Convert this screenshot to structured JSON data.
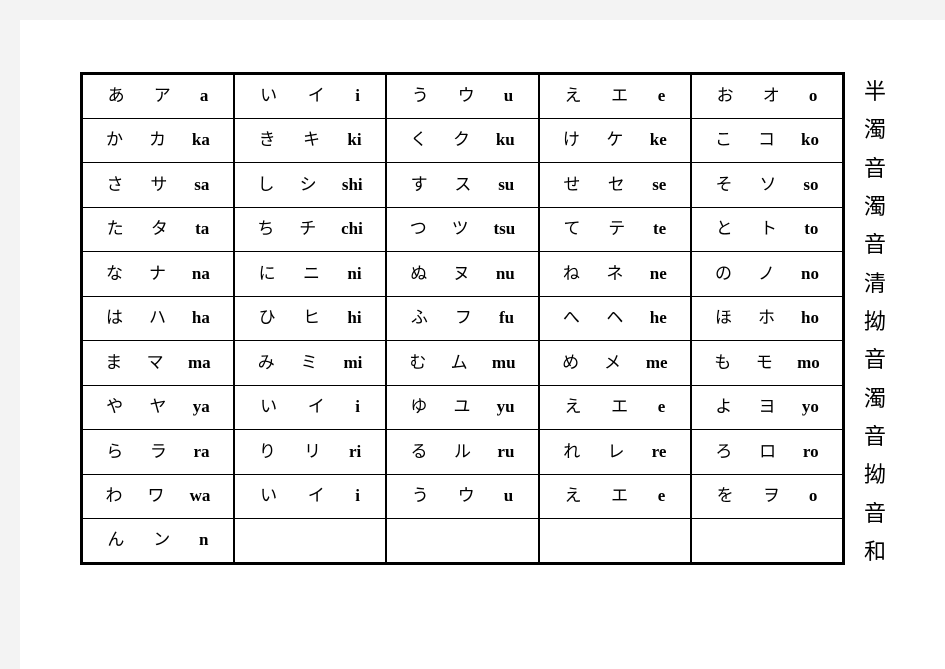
{
  "page": {
    "background_color": "#ffffff",
    "surround_color": "#f3f3f3",
    "text_color": "#000000",
    "border_color": "#000000"
  },
  "kana_table": {
    "columns": 5,
    "rows": 11,
    "cells": [
      [
        {
          "hiragana": "あ",
          "katakana": "ア",
          "romaji": "a"
        },
        {
          "hiragana": "い",
          "katakana": "イ",
          "romaji": "i"
        },
        {
          "hiragana": "う",
          "katakana": "ウ",
          "romaji": "u"
        },
        {
          "hiragana": "え",
          "katakana": "エ",
          "romaji": "e"
        },
        {
          "hiragana": "お",
          "katakana": "オ",
          "romaji": "o"
        }
      ],
      [
        {
          "hiragana": "か",
          "katakana": "カ",
          "romaji": "ka"
        },
        {
          "hiragana": "き",
          "katakana": "キ",
          "romaji": "ki"
        },
        {
          "hiragana": "く",
          "katakana": "ク",
          "romaji": "ku"
        },
        {
          "hiragana": "け",
          "katakana": "ケ",
          "romaji": "ke"
        },
        {
          "hiragana": "こ",
          "katakana": "コ",
          "romaji": "ko"
        }
      ],
      [
        {
          "hiragana": "さ",
          "katakana": "サ",
          "romaji": "sa"
        },
        {
          "hiragana": "し",
          "katakana": "シ",
          "romaji": "shi"
        },
        {
          "hiragana": "す",
          "katakana": "ス",
          "romaji": "su"
        },
        {
          "hiragana": "せ",
          "katakana": "セ",
          "romaji": "se"
        },
        {
          "hiragana": "そ",
          "katakana": "ソ",
          "romaji": "so"
        }
      ],
      [
        {
          "hiragana": "た",
          "katakana": "タ",
          "romaji": "ta"
        },
        {
          "hiragana": "ち",
          "katakana": "チ",
          "romaji": "chi"
        },
        {
          "hiragana": "つ",
          "katakana": "ツ",
          "romaji": "tsu"
        },
        {
          "hiragana": "て",
          "katakana": "テ",
          "romaji": "te"
        },
        {
          "hiragana": "と",
          "katakana": "ト",
          "romaji": "to"
        }
      ],
      [
        {
          "hiragana": "な",
          "katakana": "ナ",
          "romaji": "na"
        },
        {
          "hiragana": "に",
          "katakana": "ニ",
          "romaji": "ni"
        },
        {
          "hiragana": "ぬ",
          "katakana": "ヌ",
          "romaji": "nu"
        },
        {
          "hiragana": "ね",
          "katakana": "ネ",
          "romaji": "ne"
        },
        {
          "hiragana": "の",
          "katakana": "ノ",
          "romaji": "no"
        }
      ],
      [
        {
          "hiragana": "は",
          "katakana": "ハ",
          "romaji": "ha"
        },
        {
          "hiragana": "ひ",
          "katakana": "ヒ",
          "romaji": "hi"
        },
        {
          "hiragana": "ふ",
          "katakana": "フ",
          "romaji": "fu"
        },
        {
          "hiragana": "へ",
          "katakana": "ヘ",
          "romaji": "he"
        },
        {
          "hiragana": "ほ",
          "katakana": "ホ",
          "romaji": "ho"
        }
      ],
      [
        {
          "hiragana": "ま",
          "katakana": "マ",
          "romaji": "ma"
        },
        {
          "hiragana": "み",
          "katakana": "ミ",
          "romaji": "mi"
        },
        {
          "hiragana": "む",
          "katakana": "ム",
          "romaji": "mu"
        },
        {
          "hiragana": "め",
          "katakana": "メ",
          "romaji": "me"
        },
        {
          "hiragana": "も",
          "katakana": "モ",
          "romaji": "mo"
        }
      ],
      [
        {
          "hiragana": "や",
          "katakana": "ヤ",
          "romaji": "ya"
        },
        {
          "hiragana": "い",
          "katakana": "イ",
          "romaji": "i"
        },
        {
          "hiragana": "ゆ",
          "katakana": "ユ",
          "romaji": "yu"
        },
        {
          "hiragana": "え",
          "katakana": "エ",
          "romaji": "e"
        },
        {
          "hiragana": "よ",
          "katakana": "ヨ",
          "romaji": "yo"
        }
      ],
      [
        {
          "hiragana": "ら",
          "katakana": "ラ",
          "romaji": "ra"
        },
        {
          "hiragana": "り",
          "katakana": "リ",
          "romaji": "ri"
        },
        {
          "hiragana": "る",
          "katakana": "ル",
          "romaji": "ru"
        },
        {
          "hiragana": "れ",
          "katakana": "レ",
          "romaji": "re"
        },
        {
          "hiragana": "ろ",
          "katakana": "ロ",
          "romaji": "ro"
        }
      ],
      [
        {
          "hiragana": "わ",
          "katakana": "ワ",
          "romaji": "wa"
        },
        {
          "hiragana": "い",
          "katakana": "イ",
          "romaji": "i"
        },
        {
          "hiragana": "う",
          "katakana": "ウ",
          "romaji": "u"
        },
        {
          "hiragana": "え",
          "katakana": "エ",
          "romaji": "e"
        },
        {
          "hiragana": "を",
          "katakana": "ヲ",
          "romaji": "o"
        }
      ],
      [
        {
          "hiragana": "ん",
          "katakana": "ン",
          "romaji": "n"
        },
        {
          "hiragana": "",
          "katakana": "",
          "romaji": ""
        },
        {
          "hiragana": "",
          "katakana": "",
          "romaji": ""
        },
        {
          "hiragana": "",
          "katakana": "",
          "romaji": ""
        },
        {
          "hiragana": "",
          "katakana": "",
          "romaji": ""
        }
      ]
    ]
  },
  "side_label": {
    "orientation": "vertical",
    "text": "半濁音濁音清拗音濁音拗音和",
    "characters": [
      "半",
      "濁",
      "音",
      "濁",
      "音",
      "清",
      "拗",
      "音",
      "濁",
      "音",
      "拗",
      "音",
      "和"
    ]
  }
}
